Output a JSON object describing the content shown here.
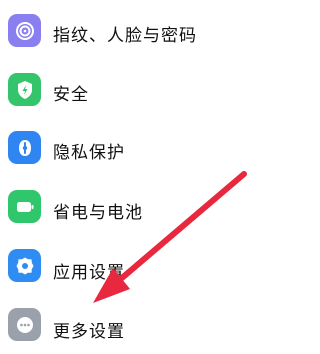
{
  "settings": {
    "items": [
      {
        "label": "指纹、人脸与密码",
        "icon": "fingerprint-icon",
        "color": "#8a7ff0"
      },
      {
        "label": "安全",
        "icon": "shield-icon",
        "color": "#34c46b"
      },
      {
        "label": "隐私保护",
        "icon": "privacy-icon",
        "color": "#2f86f2"
      },
      {
        "label": "省电与电池",
        "icon": "battery-icon",
        "color": "#2fc66c"
      },
      {
        "label": "应用设置",
        "icon": "gear-icon",
        "color": "#2f8cf2"
      },
      {
        "label": "更多设置",
        "icon": "more-icon",
        "color": "#9aa1ab"
      }
    ]
  },
  "annotation": {
    "arrow_color": "#e8283f"
  }
}
